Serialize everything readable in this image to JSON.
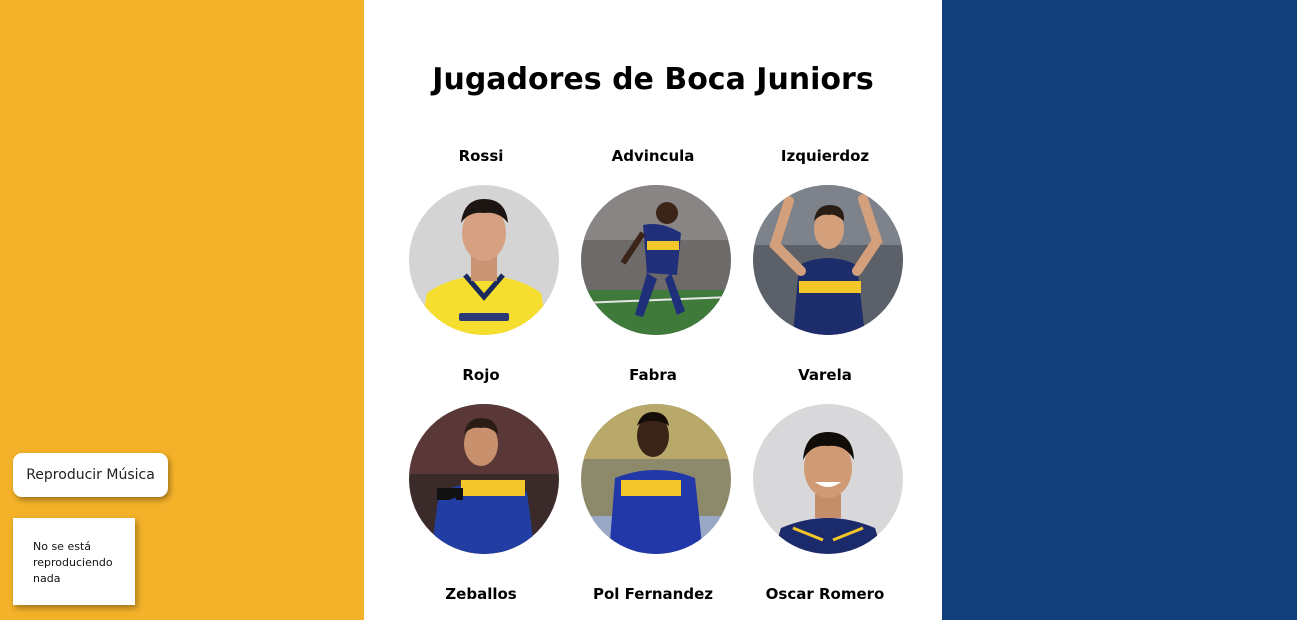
{
  "page": {
    "title": "Jugadores de Boca Juniors"
  },
  "colors": {
    "left_background": "#f3b229",
    "right_background": "#123f7c",
    "center_background": "#ffffff"
  },
  "players": [
    {
      "name": "Rossi",
      "photo": "player-photo-rossi"
    },
    {
      "name": "Advincula",
      "photo": "player-photo-advincula"
    },
    {
      "name": "Izquierdoz",
      "photo": "player-photo-izquierdoz"
    },
    {
      "name": "Rojo",
      "photo": "player-photo-rojo"
    },
    {
      "name": "Fabra",
      "photo": "player-photo-fabra"
    },
    {
      "name": "Varela",
      "photo": "player-photo-varela"
    },
    {
      "name": "Zeballos",
      "photo": "player-photo-zeballos"
    },
    {
      "name": "Pol Fernandez",
      "photo": "player-photo-pol-fernandez"
    },
    {
      "name": "Oscar Romero",
      "photo": "player-photo-oscar-romero"
    }
  ],
  "music": {
    "button_label": "Reproducir Música",
    "status_text": "No se está reproduciendo nada"
  }
}
